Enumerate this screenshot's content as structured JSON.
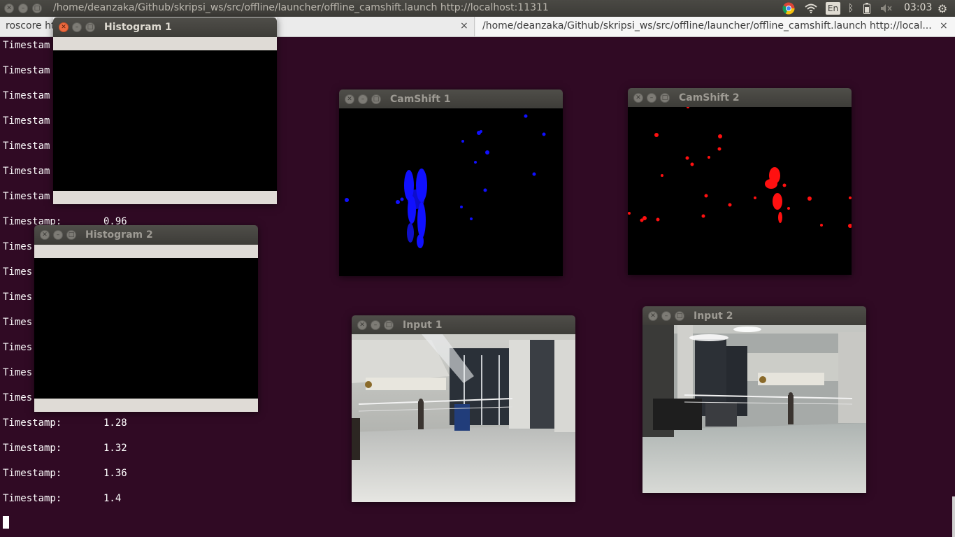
{
  "panel": {
    "title": "/home/deanzaka/Github/skripsi_ws/src/offline/launcher/offline_camshift.launch http://localhost:11311",
    "language": "En",
    "clock": "03:03"
  },
  "tabs": [
    {
      "label": "roscore ht",
      "close": "×"
    },
    {
      "label": "/home/deanzaka/Github/skripsi_ws/src/offline/launcher/offline_camshift.launch http://local...",
      "close": "×"
    }
  ],
  "terminal": {
    "lines": [
      {
        "label": "Timestam",
        "value": ""
      },
      {
        "label": "Timestam",
        "value": ""
      },
      {
        "label": "Timestam",
        "value": ""
      },
      {
        "label": "Timestam",
        "value": ""
      },
      {
        "label": "Timestam",
        "value": ""
      },
      {
        "label": "Timestam",
        "value": ""
      },
      {
        "label": "Timestam",
        "value": ""
      },
      {
        "label": "Timestamp:",
        "value": "0.96"
      },
      {
        "label": "Times",
        "value": ""
      },
      {
        "label": "Times",
        "value": ""
      },
      {
        "label": "Times",
        "value": ""
      },
      {
        "label": "Times",
        "value": ""
      },
      {
        "label": "Times",
        "value": ""
      },
      {
        "label": "Times",
        "value": ""
      },
      {
        "label": "Times",
        "value": ""
      },
      {
        "label": "Timestamp:",
        "value": "1.28"
      },
      {
        "label": "Timestamp:",
        "value": "1.32"
      },
      {
        "label": "Timestamp:",
        "value": "1.36"
      },
      {
        "label": "Timestamp:",
        "value": "1.4"
      }
    ]
  },
  "windows": {
    "histogram1": {
      "title": "Histogram 1"
    },
    "histogram2": {
      "title": "Histogram 2"
    },
    "camshift1": {
      "title": "CamShift 1",
      "blob_color": "#1010ff"
    },
    "camshift2": {
      "title": "CamShift 2",
      "blob_color": "#ff1010"
    },
    "input1": {
      "title": "Input 1"
    },
    "input2": {
      "title": "Input 2"
    }
  },
  "colors": {
    "terminal_bg": "#300a24",
    "panel_bg": "#3c3b37"
  }
}
